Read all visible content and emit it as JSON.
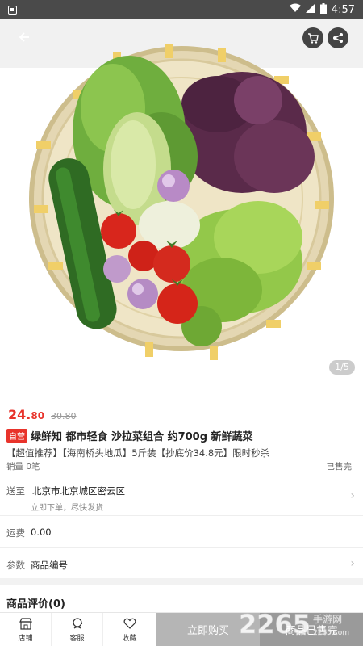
{
  "status_bar": {
    "time": "4:57"
  },
  "product": {
    "price_currency": "24.",
    "price_decimal": "80",
    "original_price": "30.80",
    "badge": "自营",
    "title": "绿鲜知 都市轻食 沙拉菜组合 约700g 新鲜蔬菜",
    "promo": "【超值推荐】【海南桥头地瓜】5斤装【抄底价34.8元】限时秒杀",
    "sales": "销量 0笔",
    "sold_out": "已售完"
  },
  "gallery": {
    "pager": "1/5"
  },
  "delivery": {
    "label": "送至",
    "address": "北京市北京城区密云区",
    "note": "立即下单，尽快发货"
  },
  "shipping": {
    "label": "运费",
    "value": "0.00"
  },
  "params": {
    "label": "参数",
    "value": "商品编号"
  },
  "reviews": {
    "title": "商品评价(0)"
  },
  "bottom_bar": {
    "store": "店铺",
    "service": "客服",
    "favorite": "收藏",
    "buy_now": "立即购买",
    "sold_out": "商品已售完"
  },
  "watermark": {
    "text": "2265",
    "sub": "手游网",
    "url": "2265.com"
  },
  "colors": {
    "accent": "#e8332b",
    "status_bar": "#4a4a4a"
  }
}
